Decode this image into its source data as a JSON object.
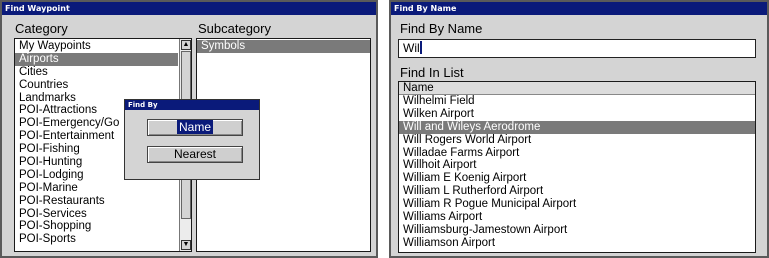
{
  "find_waypoint": {
    "title": "Find Waypoint",
    "category_label": "Category",
    "subcategory_label": "Subcategory",
    "categories": [
      {
        "label": "My Waypoints",
        "selected": false
      },
      {
        "label": "Airports",
        "selected": true
      },
      {
        "label": "Cities",
        "selected": false
      },
      {
        "label": "Countries",
        "selected": false
      },
      {
        "label": "Landmarks",
        "selected": false
      },
      {
        "label": "POI-Attractions",
        "selected": false
      },
      {
        "label": "POI-Emergency/Go",
        "selected": false
      },
      {
        "label": "POI-Entertainment",
        "selected": false
      },
      {
        "label": "POI-Fishing",
        "selected": false
      },
      {
        "label": "POI-Hunting",
        "selected": false
      },
      {
        "label": "POI-Lodging",
        "selected": false
      },
      {
        "label": "POI-Marine",
        "selected": false
      },
      {
        "label": "POI-Restaurants",
        "selected": false
      },
      {
        "label": "POI-Services",
        "selected": false
      },
      {
        "label": "POI-Shopping",
        "selected": false
      },
      {
        "label": "POI-Sports",
        "selected": false
      }
    ],
    "subcategories": [
      {
        "label": "Symbols",
        "selected": true
      }
    ],
    "find_by_dialog": {
      "title": "Find By",
      "name_button": "Name",
      "nearest_button": "Nearest"
    }
  },
  "find_by_name": {
    "title": "Find By Name",
    "field_label": "Find By Name",
    "field_value": "Wil",
    "list_label": "Find In List",
    "column_header": "Name",
    "results": [
      {
        "label": "Wilhelmi Field",
        "selected": false
      },
      {
        "label": "Wilken Airport",
        "selected": false
      },
      {
        "label": "Will and Wileys Aerodrome",
        "selected": true
      },
      {
        "label": "Will Rogers World Airport",
        "selected": false
      },
      {
        "label": "Willadae Farms Airport",
        "selected": false
      },
      {
        "label": "Willhoit Airport",
        "selected": false
      },
      {
        "label": "William E Koenig Airport",
        "selected": false
      },
      {
        "label": "William L Rutherford Airport",
        "selected": false
      },
      {
        "label": "William R Pogue Municipal Airport",
        "selected": false
      },
      {
        "label": "Williams Airport",
        "selected": false
      },
      {
        "label": "Williamsburg-Jamestown Airport",
        "selected": false
      },
      {
        "label": "Williamson Airport",
        "selected": false
      }
    ]
  },
  "colors": {
    "titlebar": "#0a1a7a",
    "panel": "#d4d4d4",
    "selection": "#7a7a7a"
  }
}
